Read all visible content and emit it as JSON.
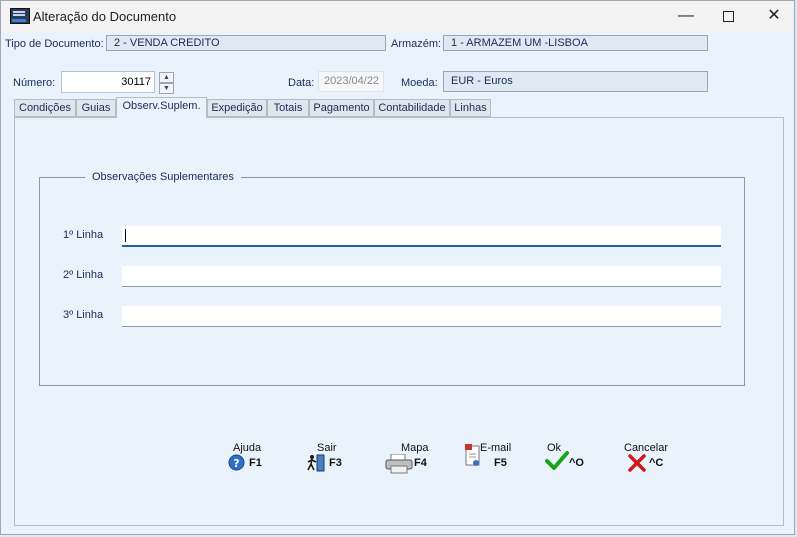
{
  "window": {
    "title": "Alteração do Documento",
    "minimize": "—",
    "close": "✕"
  },
  "header": {
    "tipo_label": "Tipo de Documento:",
    "tipo_value": "2 - VENDA CREDITO",
    "armazem_label": "Armazém:",
    "armazem_value": "1 - ARMAZEM UM -LISBOA",
    "numero_label": "Número:",
    "numero_value": "30117",
    "data_label": "Data:",
    "data_value": "2023/04/22",
    "moeda_label": "Moeda:",
    "moeda_value": "EUR - Euros"
  },
  "tabs": [
    {
      "label": "Condições"
    },
    {
      "label": "Guias"
    },
    {
      "label": "Observ.Suplem."
    },
    {
      "label": "Expedição"
    },
    {
      "label": "Totais"
    },
    {
      "label": "Pagamento"
    },
    {
      "label": "Contabilidade"
    },
    {
      "label": "Linhas"
    }
  ],
  "active_tab": "Observ.Suplem.",
  "group": {
    "title": "Observações Suplementares",
    "lines": [
      {
        "label": "1º Linha",
        "value": ""
      },
      {
        "label": "2º Linha",
        "value": ""
      },
      {
        "label": "3º Linha",
        "value": ""
      }
    ]
  },
  "footer": {
    "buttons": [
      {
        "caption": "Ajuda",
        "key": "F1",
        "icon": "help-icon"
      },
      {
        "caption": "Sair",
        "key": "F3",
        "icon": "exit-door-icon"
      },
      {
        "caption": "Mapa",
        "key": "F4",
        "icon": "printer-icon"
      },
      {
        "caption": "E-mail",
        "key": "F5",
        "icon": "email-document-icon"
      },
      {
        "caption": "Ok",
        "key": "^O",
        "icon": "check-icon"
      },
      {
        "caption": "Cancelar",
        "key": "^C",
        "icon": "cancel-x-icon"
      }
    ]
  },
  "colors": {
    "background": "#eaf3fb",
    "field": "#dfe9f3",
    "text": "#1a2a5a",
    "focus_underline": "#1f5fa3",
    "ok_green": "#1aa31a",
    "cancel_red": "#d01818"
  }
}
